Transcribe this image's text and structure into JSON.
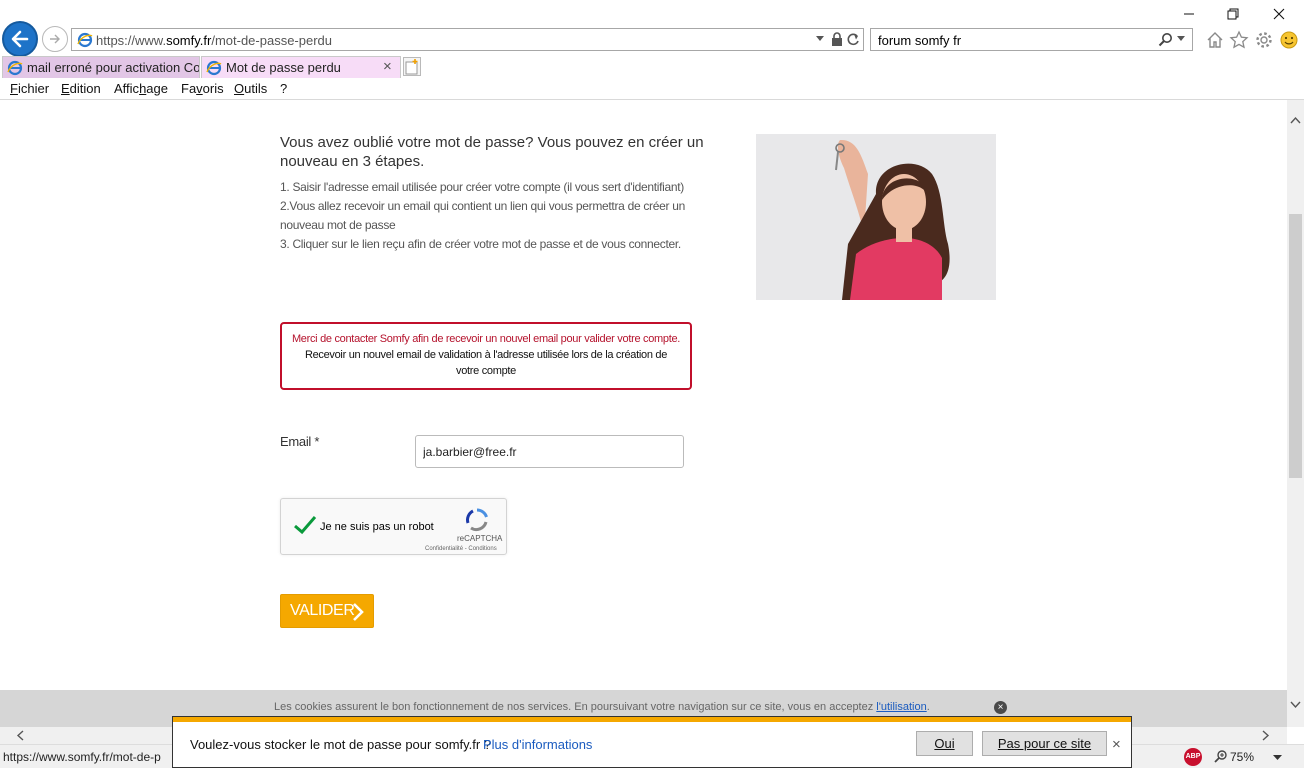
{
  "browser": {
    "url_prefix": "https://www.",
    "url_domain": "somfy.fr",
    "url_path": "/mot-de-passe-perdu",
    "search_value": "forum somfy fr",
    "tabs": [
      {
        "label": "mail erroné pour activation Co..."
      },
      {
        "label": "Mot de passe perdu"
      }
    ],
    "tab_close": "×",
    "menu": {
      "file_u": "F",
      "file_rest": "ichier",
      "edit_u": "E",
      "edit_rest": "dition",
      "view_pre": "Affic",
      "view_u": "h",
      "view_rest": "age",
      "fav_pre": "Fa",
      "fav_u": "v",
      "fav_rest": "oris",
      "tools_u": "O",
      "tools_rest": "utils",
      "help": "?"
    },
    "status_url": "https://www.somfy.fr/mot-de-p",
    "abp": "ABP",
    "zoom": "75%"
  },
  "page": {
    "intro_title": "Vous avez oublié votre mot de passe? Vous pouvez en créer un nouveau en 3 étapes.",
    "step1": "1. Saisir l'adresse email utilisée pour créer votre compte (il vous sert d'identifiant)",
    "step2": "2.Vous allez recevoir un email qui contient un lien qui vous permettra de créer un nouveau mot de passe",
    "step3": "3. Cliquer sur le lien reçu afin de créer votre mot de passe et de vous connecter.",
    "alert_line1": "Merci de contacter Somfy afin de recevoir un nouvel email pour valider votre compte.",
    "alert_line2": "Recevoir un nouvel email de validation à l'adresse utilisée lors de la création de votre compte",
    "email_label": "Email *",
    "email_value": "ja.barbier@free.fr",
    "captcha_label": "Je ne suis pas un robot",
    "captcha_brand": "reCAPTCHA",
    "captcha_terms": "Confidentialité - Conditions",
    "submit_label": "VALIDER"
  },
  "cookie": {
    "text": "Les cookies assurent le bon fonctionnement de nos services. En poursuivant votre navigation sur ce site, vous en acceptez ",
    "link": "l'utilisation",
    "tail": ".",
    "close": "×"
  },
  "notification": {
    "text": "Voulez-vous stocker le mot de passe pour somfy.fr ?",
    "more": "Plus d'informations",
    "yes": "Oui",
    "no": "Pas pour ce site",
    "close": "×"
  },
  "colors": {
    "accent": "#f5a800",
    "alert_border": "#c10f2b",
    "link": "#1a5bbf",
    "back_button": "#1e73c8"
  }
}
